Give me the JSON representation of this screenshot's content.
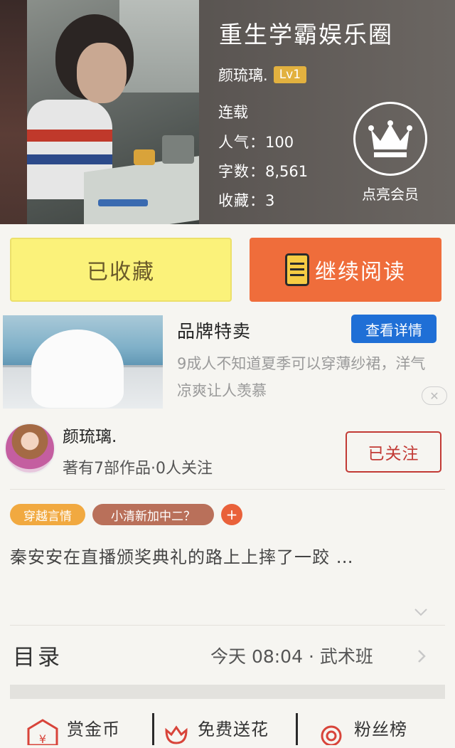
{
  "book": {
    "title": "重生学霸娱乐圈",
    "author": "颜琉璃.",
    "level": "Lv1",
    "status": "连载",
    "popularity_label": "人气：",
    "popularity": "100",
    "words_label": "字数：",
    "words": "8,561",
    "favorites_label": "收藏：",
    "favorites": "3",
    "vip_label": "点亮会员"
  },
  "actions": {
    "collected_label": "已收藏",
    "read_label": "继续阅读"
  },
  "ad": {
    "title": "品牌特卖",
    "detail_button": "查看详情",
    "description": "9成人不知道夏季可以穿薄纱裙，洋气凉爽让人羡慕",
    "close_icon": "close-icon"
  },
  "author_card": {
    "name": "颜琉璃.",
    "info": "著有7部作品·0人关注",
    "follow_label": "已关注"
  },
  "tags": [
    "穿越言情",
    "小清新加中二？"
  ],
  "tag_add": "+",
  "synopsis": "秦安安在直播颁奖典礼的路上上摔了一跤 …",
  "catalog": {
    "label": "目录",
    "update": "今天 08:04 · 武术班"
  },
  "bottom_actions": [
    {
      "label": "赏金币",
      "icon": "coin-envelope-icon"
    },
    {
      "label": "免费送花",
      "icon": "flower-icon"
    },
    {
      "label": "粉丝榜",
      "icon": "medal-icon"
    }
  ],
  "colors": {
    "collected_bg": "#fbf27a",
    "read_bg": "#ef6d3b",
    "detail_btn": "#1f6fd6",
    "follow": "#c23a35",
    "tag1": "#f1a940",
    "tag2": "#b9705a",
    "level_badge": "#e2b13f"
  }
}
